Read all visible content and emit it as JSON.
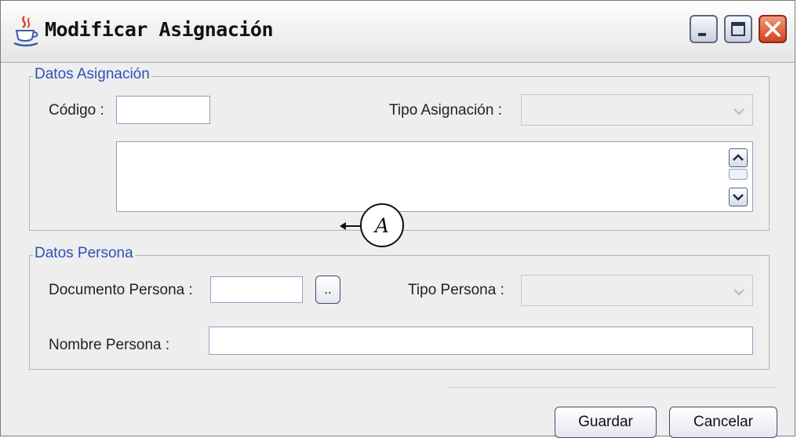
{
  "window": {
    "title": "Modificar Asignación"
  },
  "datos_asignacion": {
    "legend": "Datos Asignación",
    "codigo_label": "Código :",
    "codigo_value": "",
    "tipo_asignacion_label": "Tipo Asignación :",
    "tipo_asignacion_value": "",
    "descripcion_value": ""
  },
  "datos_persona": {
    "legend": "Datos Persona",
    "documento_label": "Documento Persona :",
    "documento_value": "",
    "browse_label": "..",
    "tipo_persona_label": "Tipo Persona :",
    "tipo_persona_value": "",
    "nombre_label": "Nombre Persona :",
    "nombre_value": ""
  },
  "annotation": {
    "marker": "A"
  },
  "buttons": {
    "guardar": "Guardar",
    "cancelar": "Cancelar"
  },
  "icons": {
    "window": "java-cup-icon",
    "minimize": "minimize-icon",
    "maximize": "maximize-icon",
    "close": "close-icon"
  }
}
